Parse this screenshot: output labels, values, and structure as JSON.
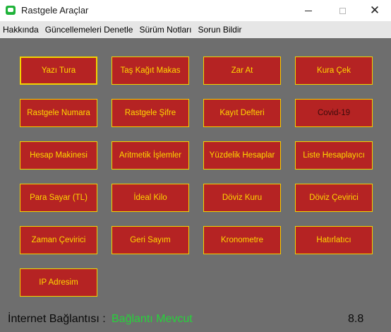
{
  "window": {
    "title": "Rastgele Araçlar",
    "close_glyph": "✕"
  },
  "menu": [
    "Hakkında",
    "Güncellemeleri Denetle",
    "Sürüm Notları",
    "Sorun Bildir"
  ],
  "buttons": [
    "Yazı Tura",
    "Taş Kağıt Makas",
    "Zar At",
    "Kura Çek",
    "Rastgele Numara",
    "Rastgele Şifre",
    "Kayıt Defteri",
    "Covid-19",
    "Hesap Makinesi",
    "Aritmetik İşlemler",
    "Yüzdelik Hesaplar",
    "Liste Hesaplayıcı",
    "Para Sayar (TL)",
    "İdeal Kilo",
    "Döviz Kuru",
    "Döviz Çevirici",
    "Zaman Çevirici",
    "Geri Sayım",
    "Kronometre",
    "Hatırlatıcı",
    "IP Adresim"
  ],
  "status": {
    "label": "İnternet Bağlantısı :",
    "value": "Bağlantı Mevcut",
    "version": "8.8"
  },
  "colors": {
    "background": "#6e6e6e",
    "button_fill": "#b52323",
    "button_border": "#f2d300",
    "button_text": "#ffd800",
    "status_ok": "#26d33a"
  },
  "icons": {
    "app": "app-icon",
    "minimize": "minimize-icon",
    "maximize": "maximize-icon",
    "close": "close-icon"
  }
}
